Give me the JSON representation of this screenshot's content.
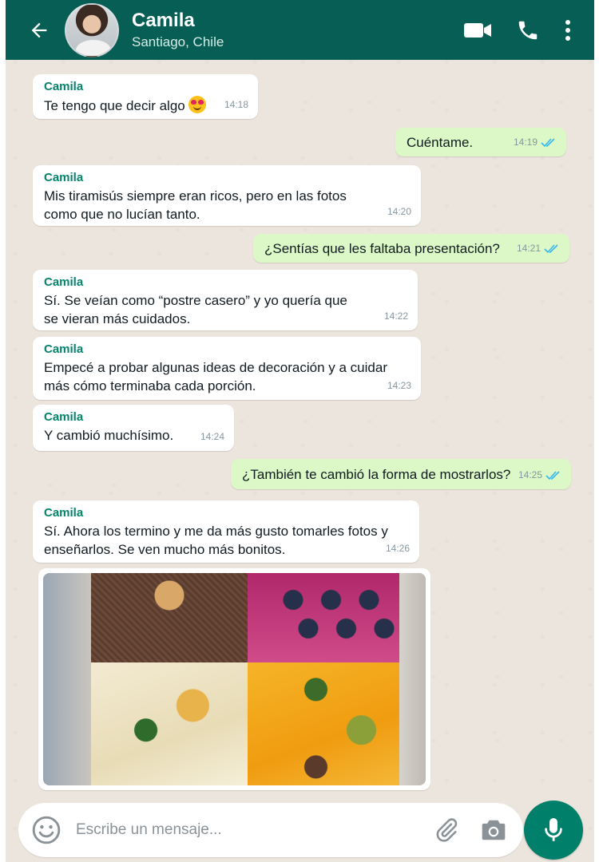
{
  "header": {
    "contact_name": "Camila",
    "contact_subtitle": "Santiago, Chile"
  },
  "messages": [
    {
      "direction": "in",
      "sender": "Camila",
      "text": "Te tengo que decir algo",
      "emoji": "smiling-face-with-heart-eyes",
      "time": "14:18"
    },
    {
      "direction": "out",
      "text": "Cuéntame.",
      "time": "14:19",
      "status": "read"
    },
    {
      "direction": "in",
      "sender": "Camila",
      "text": "Mis tiramisús siempre eran ricos, pero en las fotos como que no lucían tanto.",
      "time": "14:20"
    },
    {
      "direction": "out",
      "text": "¿Sentías que les faltaba presentación?",
      "time": "14:21",
      "status": "read"
    },
    {
      "direction": "in",
      "sender": "Camila",
      "text": "Sí. Se veían como “postre casero” y yo quería que se vieran más cuidados.",
      "time": "14:22"
    },
    {
      "direction": "in",
      "sender": "Camila",
      "text": "Empecé a probar algunas ideas de decoración y a cuidar más cómo terminaba cada porción.",
      "time": "14:23"
    },
    {
      "direction": "in",
      "sender": "Camila",
      "text": "Y cambió muchísimo.",
      "time": "14:24"
    },
    {
      "direction": "out",
      "text": "¿También te cambió la forma de mostrarlos?",
      "time": "14:25",
      "status": "read"
    },
    {
      "direction": "in",
      "sender": "Camila",
      "text": "Sí. Ahora los termino y me da más gusto tomarles fotos y enseñarlos. Se ven mucho más bonitos.",
      "time": "14:26"
    }
  ],
  "composer": {
    "placeholder": "Escribe un mensaje..."
  },
  "colors": {
    "header_bg": "#075e54",
    "outgoing_bubble": "#dcf8c6",
    "incoming_bubble": "#ffffff",
    "sender_name": "#06836b",
    "read_ticks": "#34b7f1",
    "mic_button": "#00806b"
  }
}
